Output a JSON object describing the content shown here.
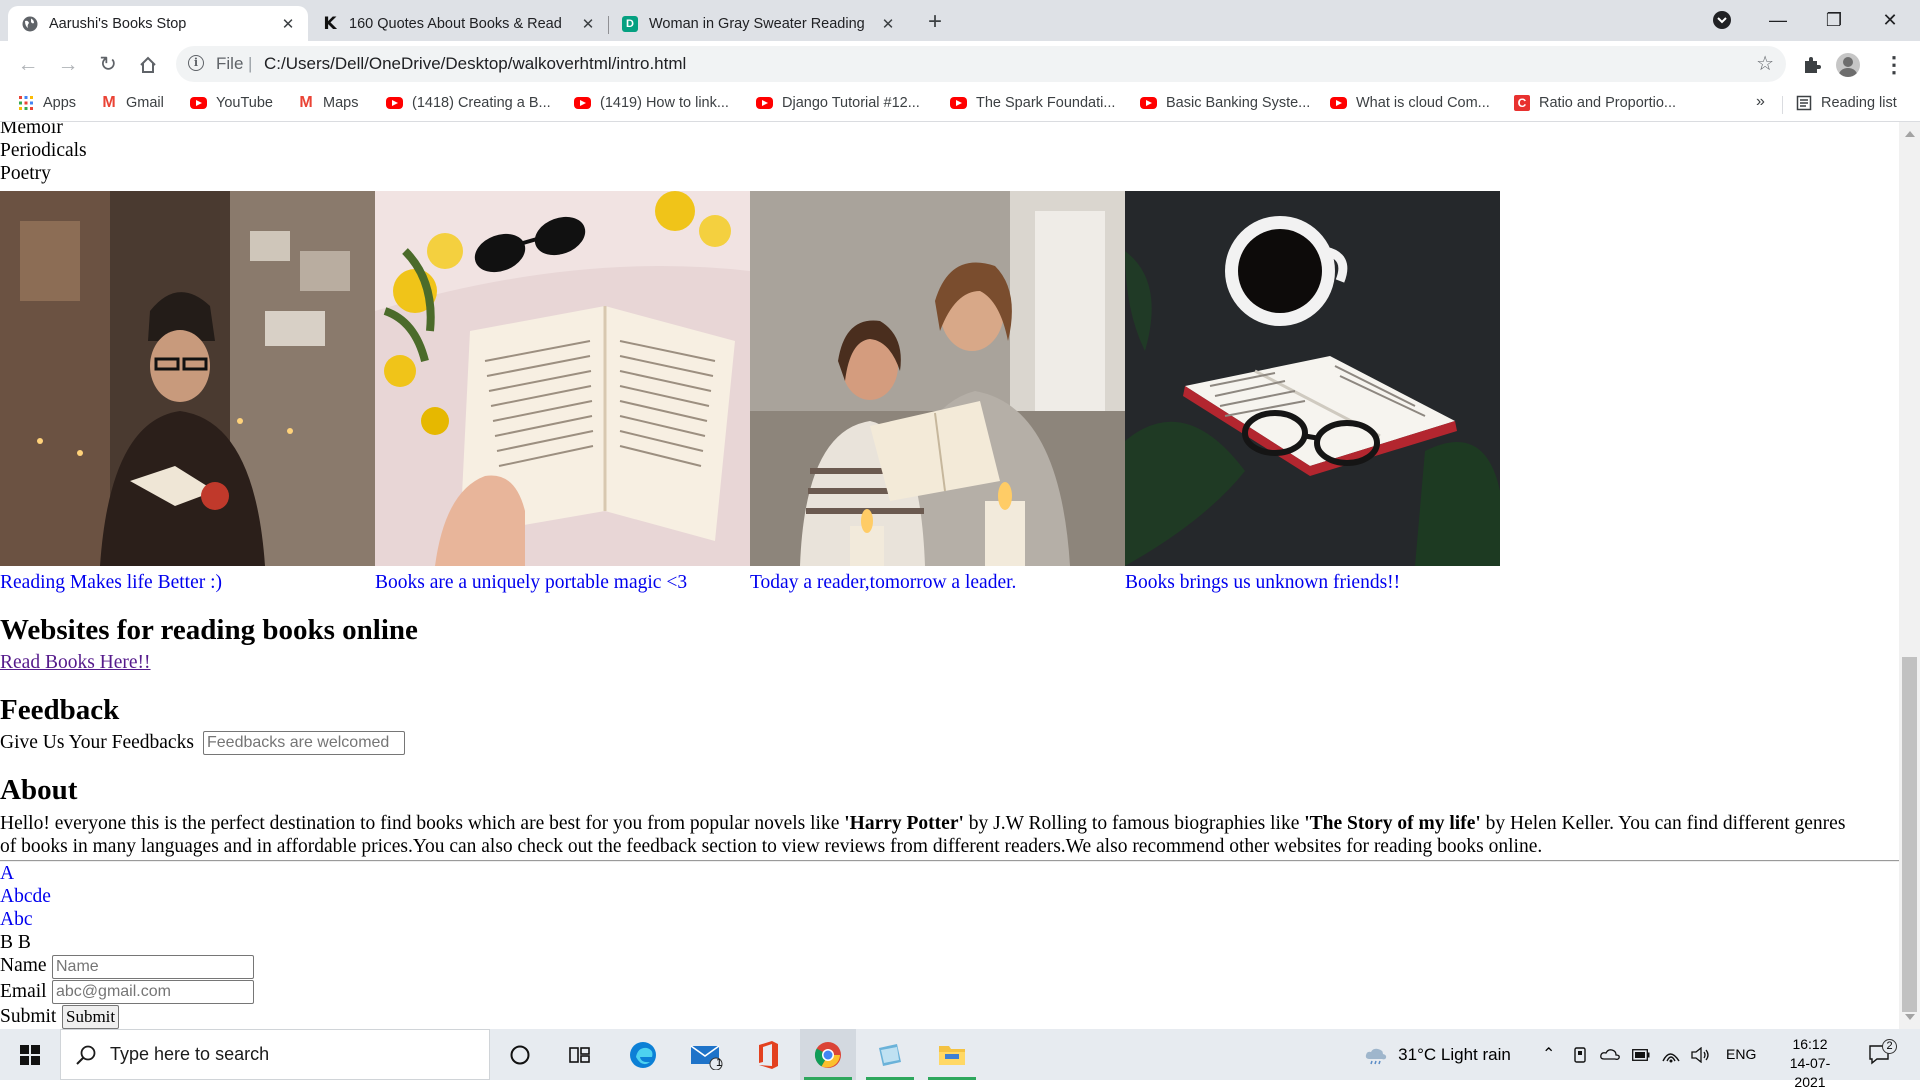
{
  "browser": {
    "tabs": [
      {
        "title": "Aarushi's Books Stop",
        "active": true,
        "icon": "globe-icon"
      },
      {
        "title": "160 Quotes About Books & Read",
        "active": false,
        "icon": "k-icon"
      },
      {
        "title": "Woman in Gray Sweater Reading",
        "active": false,
        "icon": "d-icon"
      }
    ],
    "new_tab": "+",
    "window_controls": {
      "minimize": "—",
      "restore": "❐",
      "close": "✕"
    },
    "address": {
      "scheme_label": "File",
      "url": "C:/Users/Dell/OneDrive/Desktop/walkoverhtml/intro.html"
    },
    "bookmarks": [
      {
        "label": "Apps",
        "icon": "apps-grid-icon"
      },
      {
        "label": "Gmail",
        "icon": "gmail-icon"
      },
      {
        "label": "YouTube",
        "icon": "youtube-icon"
      },
      {
        "label": "Maps",
        "icon": "gmail-icon"
      },
      {
        "label": "(1418) Creating a B...",
        "icon": "youtube-icon"
      },
      {
        "label": "(1419) How to link...",
        "icon": "youtube-icon"
      },
      {
        "label": "Django Tutorial #12...",
        "icon": "youtube-icon"
      },
      {
        "label": "The Spark Foundati...",
        "icon": "youtube-icon"
      },
      {
        "label": "Basic Banking Syste...",
        "icon": "youtube-icon"
      },
      {
        "label": "What is cloud Com...",
        "icon": "youtube-icon"
      },
      {
        "label": "Ratio and Proportio...",
        "icon": "c-icon"
      }
    ],
    "bookmarks_more": "»",
    "reading_list": "Reading list"
  },
  "page": {
    "genres": [
      "Memoir",
      "Periodicals",
      "Poetry"
    ],
    "gallery": [
      {
        "caption": "Reading Makes life Better :)"
      },
      {
        "caption": "Books are a uniquely portable magic <3"
      },
      {
        "caption": "Today a reader,tomorrow a leader."
      },
      {
        "caption": "Books brings us unknown friends!!"
      }
    ],
    "websites": {
      "heading": "Websites for reading books online",
      "link": "Read Books Here!!"
    },
    "feedback": {
      "heading": "Feedback",
      "label": "Give Us Your Feedbacks",
      "placeholder": "Feedbacks are welcomed"
    },
    "about": {
      "heading": "About",
      "line1_a": "Hello! everyone this is the perfect destination to find books which are best for you from popular novels like ",
      "line1_b": "'Harry Potter'",
      "line1_c": " by J.W Rolling to famous biographies like ",
      "line1_d": "'The Story of my life'",
      "line1_e": " by Helen Keller. You can find different genres",
      "line2": "of books in many languages and in affordable prices.You can also check out the feedback section to view reviews from different readers.We also recommend other websites for reading books online."
    },
    "links": [
      "A",
      "Abcde",
      "Abc"
    ],
    "bb_text": "B B",
    "form": {
      "name_label": "Name",
      "name_placeholder": "Name",
      "email_label": "Email",
      "email_placeholder": "abc@gmail.com",
      "submit_label": "Submit",
      "submit_button": "Submit"
    }
  },
  "taskbar": {
    "search_placeholder": "Type here to search",
    "weather": "31°C  Light rain",
    "language": "ENG",
    "time": "16:12",
    "date": "14-07-2021",
    "notification_count": "2",
    "mail_badge": "1"
  }
}
